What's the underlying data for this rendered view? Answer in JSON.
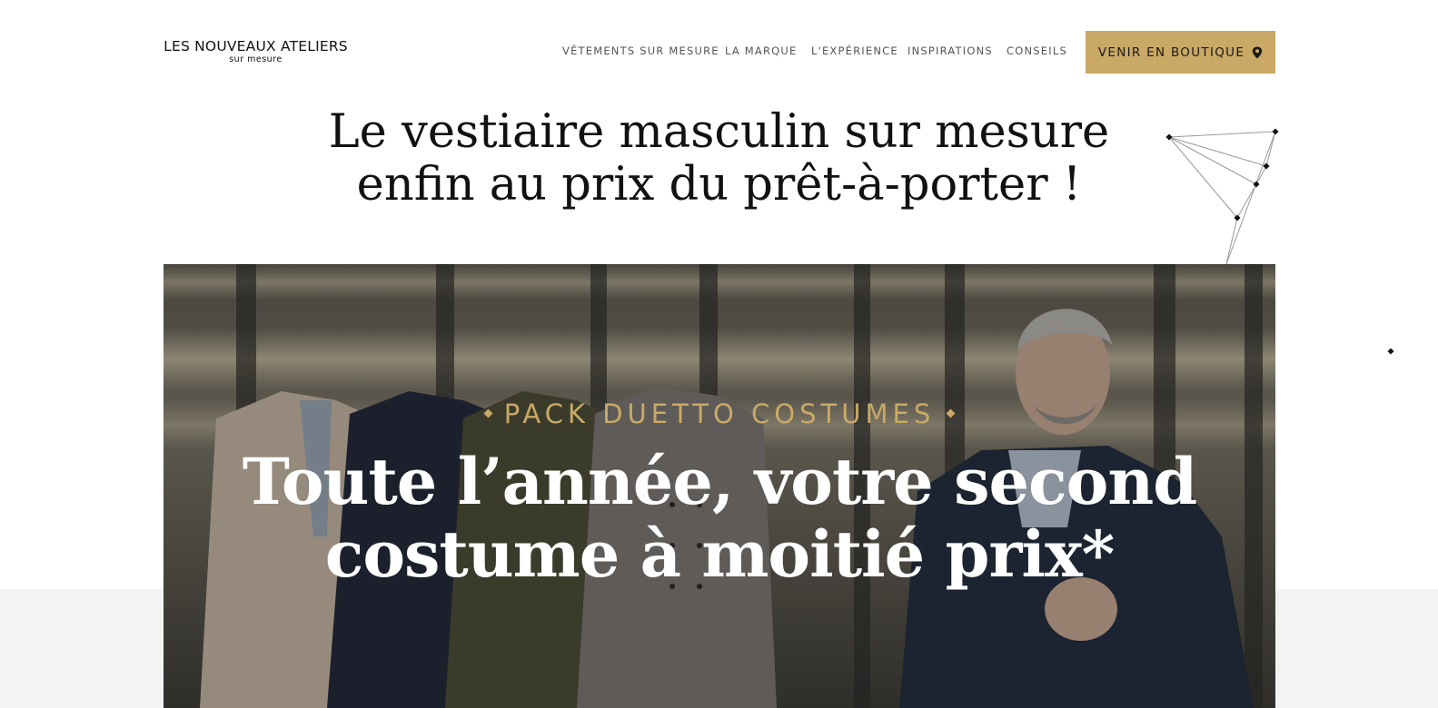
{
  "header": {
    "logo_main": "LES NOUVEAUX ATELIERS",
    "logo_sub": "sur mesure",
    "nav": [
      {
        "label": "VÊTEMENTS SUR MESURE"
      },
      {
        "label": "LA MARQUE"
      },
      {
        "label": "L'EXPÉRIENCE"
      },
      {
        "label": "INSPIRATIONS"
      },
      {
        "label": "CONSEILS"
      }
    ],
    "cta_label": "VENIR EN BOUTIQUE",
    "cta_icon": "location-pin-icon"
  },
  "hero": {
    "title_line1": "Le vestiaire masculin sur mesure",
    "title_line2": "enfin au prix du prêt-à-porter !"
  },
  "banner": {
    "eyebrow": "PACK DUETTO COSTUMES",
    "title_line1": "Toute l’année, votre second",
    "title_line2": "costume à moitié prix*"
  },
  "colors": {
    "accent_gold": "#c9a965",
    "text_dark": "#111111",
    "nav_gray": "#555555",
    "band_gray": "#f3f3f3"
  }
}
